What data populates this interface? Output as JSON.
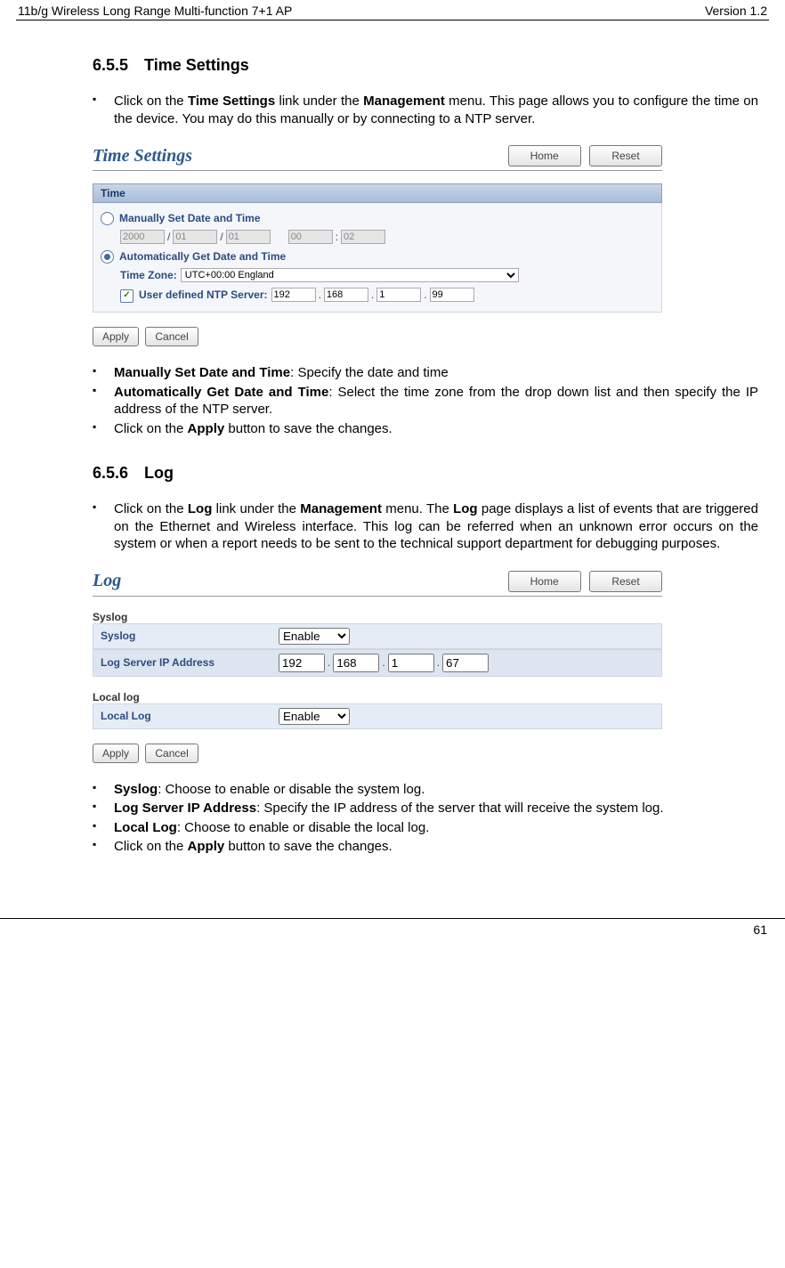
{
  "header": {
    "left": "11b/g Wireless Long Range Multi-function 7+1 AP",
    "right": "Version 1.2"
  },
  "s655": {
    "num": "6.5.5",
    "title": "Time Settings",
    "intro_pre": "Click on the ",
    "intro_b1": "Time Settings",
    "intro_mid": " link under the ",
    "intro_b2": "Management",
    "intro_post": " menu. This page allows you to configure the time on the device. You may do this manually or by connecting to a NTP server.",
    "ui": {
      "title": "Time Settings",
      "home": "Home",
      "reset": "Reset",
      "section": "Time",
      "manual_label": "Manually Set Date and Time",
      "manual": {
        "y": "2000",
        "m": "01",
        "d": "01",
        "hh": "00",
        "mm": "02"
      },
      "auto_label": "Automatically Get Date and Time",
      "tz_label": "Time Zone:",
      "tz_value": "UTC+00:00 England",
      "ntp_label": "User defined NTP Server:",
      "ntp": {
        "a": "192",
        "b": "168",
        "c": "1",
        "d": "99"
      },
      "apply": "Apply",
      "cancel": "Cancel"
    },
    "b1_b": "Manually Set Date and Time",
    "b1_t": ": Specify the date and time",
    "b2_b": "Automatically Get Date and Time",
    "b2_t": ": Select the time zone from the drop down list and then specify the IP address of the NTP server.",
    "b3_pre": "Click on the ",
    "b3_b": "Apply",
    "b3_post": " button to save the changes."
  },
  "s656": {
    "num": "6.5.6",
    "title": "Log",
    "intro_pre": "Click on the ",
    "intro_b1": "Log",
    "intro_mid": " link under the ",
    "intro_b2": "Management",
    "intro_mid2": " menu. The ",
    "intro_b3": "Log",
    "intro_post": " page displays a list of events that are triggered on the Ethernet and Wireless interface. This log can be referred when an unknown error occurs on the system or when a report needs to be sent to the technical support department for debugging purposes.",
    "ui": {
      "title": "Log",
      "home": "Home",
      "reset": "Reset",
      "syslog_section": "Syslog",
      "syslog_label": "Syslog",
      "enable": "Enable",
      "logip_label": "Log Server IP Address",
      "ip": {
        "a": "192",
        "b": "168",
        "c": "1",
        "d": "67"
      },
      "locallog_section": "Local log",
      "locallog_label": "Local Log",
      "apply": "Apply",
      "cancel": "Cancel"
    },
    "b1_b": "Syslog",
    "b1_t": ": Choose to enable or disable the system log.",
    "b2_b": "Log Server IP Address",
    "b2_t": ": Specify the IP address of the server that will receive the system log.",
    "b3_b": "Local Log",
    "b3_t": ": Choose to enable or disable the local log.",
    "b4_pre": "Click on the ",
    "b4_b": "Apply",
    "b4_post": " button to save the changes."
  },
  "page_number": "61"
}
